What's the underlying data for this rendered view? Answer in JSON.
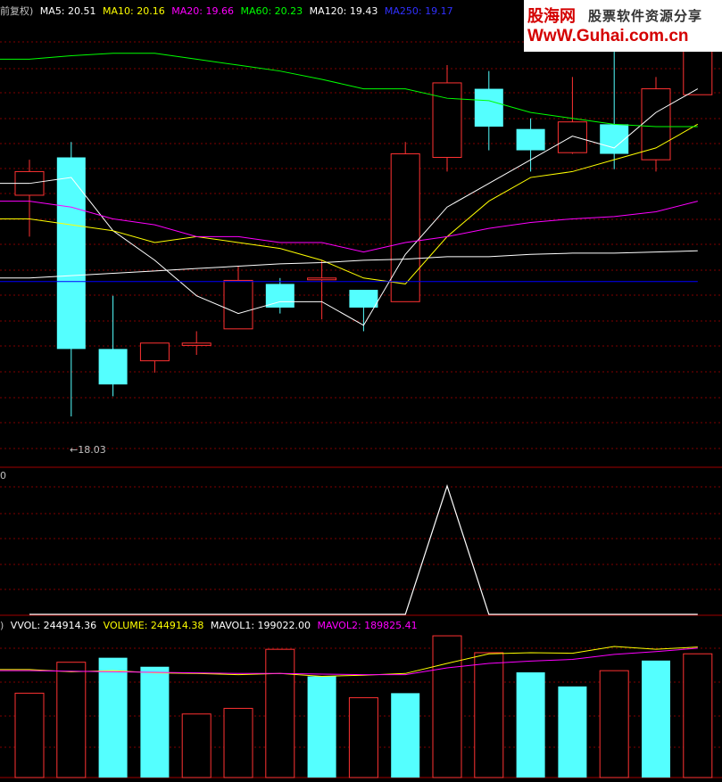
{
  "brand": {
    "logo": "股海网",
    "slogan": "股票软件资源分享",
    "url": "WwW.Guhai.com.cn"
  },
  "main_legend": {
    "prefix": "前复权)",
    "items": [
      {
        "label": "MA5: 20.51",
        "color": "#ffffff"
      },
      {
        "label": "MA10: 20.16",
        "color": "#ffff00"
      },
      {
        "label": "MA20: 19.66",
        "color": "#ff00ff"
      },
      {
        "label": "MA60: 20.23",
        "color": "#00ff00"
      },
      {
        "label": "MA120: 19.43",
        "color": "#ffffff"
      },
      {
        "label": "MA250: 19.17",
        "color": "#0000ff"
      }
    ]
  },
  "low_label": "18.03",
  "mid_panel": {
    "label": "0"
  },
  "vol_legend": {
    "prefix": ")",
    "items": [
      {
        "label": "VVOL: 244914.36",
        "color": "#ffffff"
      },
      {
        "label": "VOLUME: 244914.38",
        "color": "#ffff00"
      },
      {
        "label": "MAVOL1: 199022.00",
        "color": "#ffffff"
      },
      {
        "label": "MAVOL2: 189825.41",
        "color": "#ff00ff"
      }
    ]
  },
  "chart_data": [
    {
      "type": "candlestick",
      "title": "",
      "ylim": [
        17.6,
        21.4
      ],
      "candles": [
        {
          "o": 19.9,
          "h": 20.2,
          "l": 19.55,
          "c": 20.1,
          "up": true
        },
        {
          "o": 20.22,
          "h": 20.35,
          "l": 18.03,
          "c": 18.6,
          "up": false
        },
        {
          "o": 18.6,
          "h": 19.05,
          "l": 18.2,
          "c": 18.3,
          "up": false
        },
        {
          "o": 18.5,
          "h": 18.6,
          "l": 18.4,
          "c": 18.65,
          "up": true
        },
        {
          "o": 18.63,
          "h": 18.75,
          "l": 18.55,
          "c": 18.65,
          "up": true
        },
        {
          "o": 18.77,
          "h": 19.3,
          "l": 18.77,
          "c": 19.18,
          "up": true
        },
        {
          "o": 18.95,
          "h": 19.2,
          "l": 18.9,
          "c": 19.15,
          "up": false
        },
        {
          "o": 19.2,
          "h": 19.35,
          "l": 18.85,
          "c": 19.2,
          "up": true
        },
        {
          "o": 19.1,
          "h": 19.05,
          "l": 18.75,
          "c": 18.95,
          "up": false
        },
        {
          "o": 19.0,
          "h": 20.35,
          "l": 19.0,
          "c": 20.25,
          "up": true
        },
        {
          "o": 20.22,
          "h": 21.0,
          "l": 20.1,
          "c": 20.85,
          "up": true
        },
        {
          "o": 20.8,
          "h": 20.95,
          "l": 20.28,
          "c": 20.48,
          "up": false
        },
        {
          "o": 20.46,
          "h": 20.55,
          "l": 20.1,
          "c": 20.28,
          "up": false
        },
        {
          "o": 20.52,
          "h": 20.9,
          "l": 20.25,
          "c": 20.26,
          "up": true
        },
        {
          "o": 20.5,
          "h": 21.2,
          "l": 20.12,
          "c": 20.25,
          "up": false
        },
        {
          "o": 20.2,
          "h": 20.9,
          "l": 20.1,
          "c": 20.8,
          "up": true
        },
        {
          "o": 20.75,
          "h": 21.3,
          "l": 20.75,
          "c": 21.3,
          "up": true
        }
      ],
      "ma_series": [
        {
          "name": "MA5",
          "color": "#ffffff",
          "values": [
            20.0,
            20.05,
            19.6,
            19.35,
            19.05,
            18.9,
            19.0,
            19.0,
            18.8,
            19.4,
            19.8,
            20.0,
            20.2,
            20.4,
            20.3,
            20.6,
            20.8
          ]
        },
        {
          "name": "MA10",
          "color": "#ffff00",
          "values": [
            19.7,
            19.65,
            19.6,
            19.5,
            19.55,
            19.5,
            19.45,
            19.35,
            19.2,
            19.15,
            19.55,
            19.85,
            20.05,
            20.1,
            20.2,
            20.3,
            20.5
          ]
        },
        {
          "name": "MA20",
          "color": "#ff00ff",
          "values": [
            19.85,
            19.8,
            19.7,
            19.65,
            19.55,
            19.55,
            19.5,
            19.5,
            19.42,
            19.5,
            19.55,
            19.62,
            19.67,
            19.7,
            19.72,
            19.76,
            19.85
          ]
        },
        {
          "name": "MA60",
          "color": "#00ff00",
          "values": [
            21.05,
            21.08,
            21.1,
            21.1,
            21.05,
            21.0,
            20.95,
            20.88,
            20.8,
            20.8,
            20.72,
            20.7,
            20.6,
            20.55,
            20.5,
            20.48,
            20.48
          ]
        },
        {
          "name": "MA120",
          "color": "#ffffff",
          "values": [
            19.2,
            19.22,
            19.24,
            19.26,
            19.28,
            19.3,
            19.32,
            19.33,
            19.35,
            19.36,
            19.38,
            19.38,
            19.4,
            19.41,
            19.41,
            19.42,
            19.43
          ]
        },
        {
          "name": "MA250",
          "color": "#0000ff",
          "values": [
            19.17,
            19.17,
            19.17,
            19.17,
            19.17,
            19.17,
            19.17,
            19.17,
            19.17,
            19.17,
            19.17,
            19.17,
            19.17,
            19.17,
            19.17,
            19.17,
            19.17
          ]
        }
      ]
    },
    {
      "type": "line",
      "title": "",
      "ylim": [
        0,
        1
      ],
      "series": [
        {
          "values": [
            0,
            0,
            0,
            0,
            0,
            0,
            0,
            0,
            0,
            0,
            1,
            0,
            0,
            0,
            0,
            0,
            0
          ]
        }
      ]
    },
    {
      "type": "bar",
      "title": "",
      "ylim": [
        0,
        260000
      ],
      "values": [
        150000,
        205000,
        213000,
        197000,
        113000,
        123000,
        228000,
        180000,
        142000,
        150000,
        252000,
        222000,
        187000,
        162000,
        190000,
        208000,
        220000
      ],
      "up": [
        true,
        true,
        false,
        false,
        true,
        true,
        true,
        false,
        true,
        false,
        true,
        true,
        false,
        false,
        true,
        false,
        true
      ],
      "mavol1": [
        192000,
        188000,
        190000,
        186000,
        185000,
        183000,
        185000,
        180000,
        182000,
        185000,
        203000,
        220000,
        222000,
        221000,
        233000,
        228000,
        232000
      ],
      "mavol2": [
        190000,
        189000,
        188000,
        187000,
        186000,
        185000,
        185000,
        184000,
        183000,
        183000,
        195000,
        203000,
        207000,
        210000,
        219000,
        224000,
        230000
      ]
    }
  ]
}
